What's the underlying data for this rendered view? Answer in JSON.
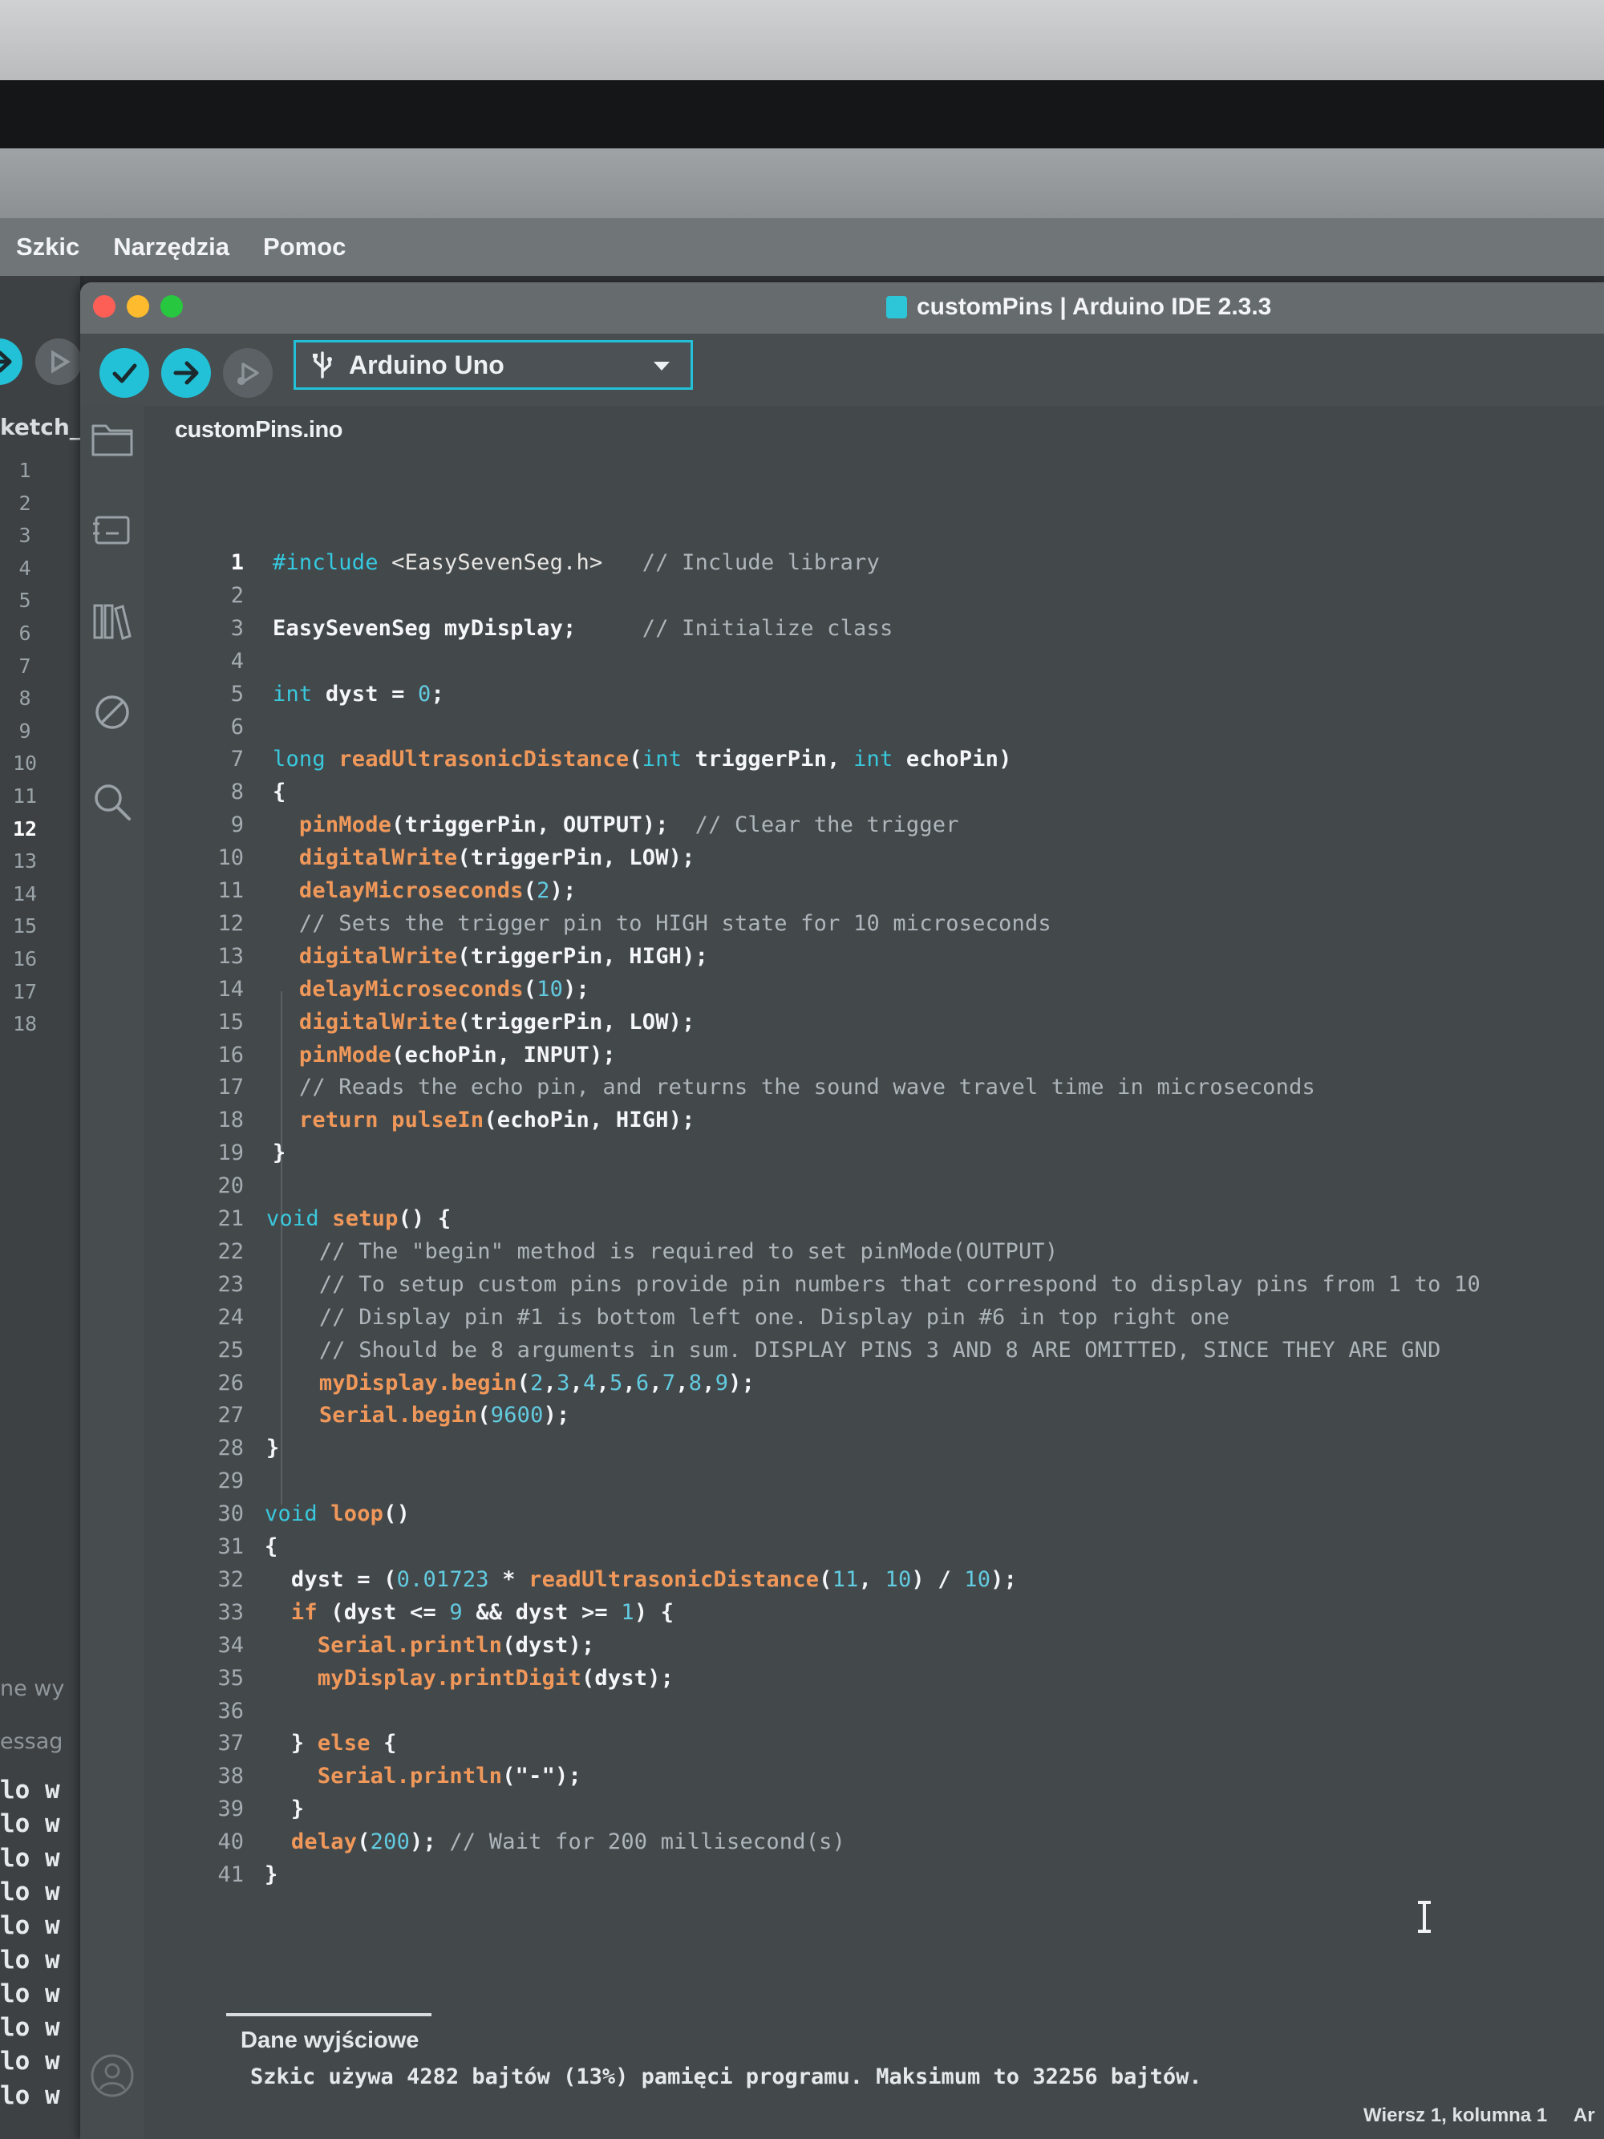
{
  "menubar": {
    "items": [
      "Szkic",
      "Narzędzia",
      "Pomoc"
    ]
  },
  "window": {
    "title": "customPins | Arduino IDE 2.3.3"
  },
  "toolbar": {
    "verify_icon": "check-icon",
    "upload_icon": "arrow-right-icon",
    "debug_icon": "debug-icon",
    "board_selector": {
      "label": "Arduino Uno",
      "icon": "usb-icon"
    }
  },
  "background_window": {
    "tab_label": "ketch_ju",
    "line_numbers": [
      "1",
      "2",
      "3",
      "4",
      "5",
      "6",
      "7",
      "8",
      "9",
      "10",
      "11",
      "12",
      "13",
      "14",
      "15",
      "16",
      "17",
      "18"
    ],
    "current_line": "12",
    "panel_fragments": [
      "ne wy",
      "essag"
    ],
    "output_lines": [
      "lo w",
      "lo w",
      "lo w",
      "lo w",
      "lo w",
      "lo w",
      "lo w",
      "lo w",
      "lo w",
      "lo w"
    ]
  },
  "sidebar": {
    "icons": [
      "folder-icon",
      "board-manager-icon",
      "library-icon",
      "debug-off-icon",
      "search-icon"
    ]
  },
  "editor": {
    "tab_label": "customPins.ino",
    "current_line": "1",
    "lines": [
      [
        [
          "p",
          "#include "
        ],
        [
          "s",
          "<EasySevenSeg.h>"
        ],
        [
          "c",
          "   // Include library"
        ]
      ],
      [],
      [
        [
          "t",
          "EasySevenSeg myDisplay;"
        ],
        [
          "c",
          "     // Initialize class"
        ]
      ],
      [],
      [
        [
          "k",
          "int"
        ],
        [
          "t",
          " dyst = "
        ],
        [
          "n",
          "0"
        ],
        [
          "t",
          ";"
        ]
      ],
      [],
      [
        [
          "k",
          "long "
        ],
        [
          "f",
          "readUltrasonicDistance"
        ],
        [
          "t",
          "("
        ],
        [
          "k",
          "int"
        ],
        [
          "t",
          " triggerPin, "
        ],
        [
          "k",
          "int"
        ],
        [
          "t",
          " echoPin)"
        ]
      ],
      [
        [
          "t",
          "{"
        ]
      ],
      [
        [
          "t",
          "  "
        ],
        [
          "o",
          "pinMode"
        ],
        [
          "t",
          "(triggerPin, OUTPUT);"
        ],
        [
          "c",
          "  // Clear the trigger"
        ]
      ],
      [
        [
          "t",
          "  "
        ],
        [
          "o",
          "digitalWrite"
        ],
        [
          "t",
          "(triggerPin, LOW);"
        ]
      ],
      [
        [
          "t",
          "  "
        ],
        [
          "o",
          "delayMicroseconds"
        ],
        [
          "t",
          "("
        ],
        [
          "n",
          "2"
        ],
        [
          "t",
          ");"
        ]
      ],
      [
        [
          "c",
          "  // Sets the trigger pin to HIGH state for 10 microseconds"
        ]
      ],
      [
        [
          "t",
          "  "
        ],
        [
          "o",
          "digitalWrite"
        ],
        [
          "t",
          "(triggerPin, HIGH);"
        ]
      ],
      [
        [
          "t",
          "  "
        ],
        [
          "o",
          "delayMicroseconds"
        ],
        [
          "t",
          "("
        ],
        [
          "n",
          "10"
        ],
        [
          "t",
          ");"
        ]
      ],
      [
        [
          "t",
          "  "
        ],
        [
          "o",
          "digitalWrite"
        ],
        [
          "t",
          "(triggerPin, LOW);"
        ]
      ],
      [
        [
          "t",
          "  "
        ],
        [
          "o",
          "pinMode"
        ],
        [
          "t",
          "(echoPin, INPUT);"
        ]
      ],
      [
        [
          "c",
          "  // Reads the echo pin, and returns the sound wave travel time in microseconds"
        ]
      ],
      [
        [
          "t",
          "  "
        ],
        [
          "o",
          "return "
        ],
        [
          "o",
          "pulseIn"
        ],
        [
          "t",
          "(echoPin, HIGH);"
        ]
      ],
      [
        [
          "t",
          "}"
        ]
      ],
      [],
      [
        [
          "k",
          "void "
        ],
        [
          "f",
          "setup"
        ],
        [
          "t",
          "() {"
        ]
      ],
      [
        [
          "c",
          "    // The \"begin\" method is required to set pinMode(OUTPUT)"
        ]
      ],
      [
        [
          "c",
          "    // To setup custom pins provide pin numbers that correspond to display pins from 1 to 10"
        ]
      ],
      [
        [
          "c",
          "    // Display pin #1 is bottom left one. Display pin #6 in top right one"
        ]
      ],
      [
        [
          "c",
          "    // Should be 8 arguments in sum. DISPLAY PINS 3 AND 8 ARE OMITTED, SINCE THEY ARE GND"
        ]
      ],
      [
        [
          "t",
          "    "
        ],
        [
          "o",
          "myDisplay.begin"
        ],
        [
          "t",
          "("
        ],
        [
          "n",
          "2"
        ],
        [
          "t",
          ","
        ],
        [
          "n",
          "3"
        ],
        [
          "t",
          ","
        ],
        [
          "n",
          "4"
        ],
        [
          "t",
          ","
        ],
        [
          "n",
          "5"
        ],
        [
          "t",
          ","
        ],
        [
          "n",
          "6"
        ],
        [
          "t",
          ","
        ],
        [
          "n",
          "7"
        ],
        [
          "t",
          ","
        ],
        [
          "n",
          "8"
        ],
        [
          "t",
          ","
        ],
        [
          "n",
          "9"
        ],
        [
          "t",
          ");"
        ]
      ],
      [
        [
          "t",
          "    "
        ],
        [
          "o",
          "Serial.begin"
        ],
        [
          "t",
          "("
        ],
        [
          "n",
          "9600"
        ],
        [
          "t",
          ");"
        ]
      ],
      [
        [
          "t",
          "}"
        ]
      ],
      [],
      [
        [
          "k",
          "void "
        ],
        [
          "f",
          "loop"
        ],
        [
          "t",
          "()"
        ]
      ],
      [
        [
          "t",
          "{"
        ]
      ],
      [
        [
          "t",
          "  dyst = ("
        ],
        [
          "n",
          "0.01723"
        ],
        [
          "t",
          " * "
        ],
        [
          "f",
          "readUltrasonicDistance"
        ],
        [
          "t",
          "("
        ],
        [
          "n",
          "11"
        ],
        [
          "t",
          ", "
        ],
        [
          "n",
          "10"
        ],
        [
          "t",
          ") / "
        ],
        [
          "n",
          "10"
        ],
        [
          "t",
          ");"
        ]
      ],
      [
        [
          "t",
          "  "
        ],
        [
          "o",
          "if"
        ],
        [
          "t",
          " (dyst <= "
        ],
        [
          "n",
          "9"
        ],
        [
          "t",
          " && dyst >= "
        ],
        [
          "n",
          "1"
        ],
        [
          "t",
          ") {"
        ]
      ],
      [
        [
          "t",
          "    "
        ],
        [
          "o",
          "Serial.println"
        ],
        [
          "t",
          "(dyst);"
        ]
      ],
      [
        [
          "t",
          "    "
        ],
        [
          "o",
          "myDisplay.printDigit"
        ],
        [
          "t",
          "(dyst);"
        ]
      ],
      [],
      [
        [
          "t",
          "  } "
        ],
        [
          "o",
          "else"
        ],
        [
          "t",
          " {"
        ]
      ],
      [
        [
          "t",
          "    "
        ],
        [
          "o",
          "Serial.println"
        ],
        [
          "t",
          "(\"-\");"
        ]
      ],
      [
        [
          "t",
          "  }"
        ]
      ],
      [
        [
          "t",
          "  "
        ],
        [
          "o",
          "delay"
        ],
        [
          "t",
          "("
        ],
        [
          "n",
          "200"
        ],
        [
          "t",
          ");"
        ],
        [
          "c",
          " // Wait for 200 millisecond(s)"
        ]
      ],
      [
        [
          "t",
          "}"
        ]
      ]
    ]
  },
  "output": {
    "tab_label": "Dane wyjściowe",
    "message": "Szkic używa 4282 bajtów (13%) pamięci programu. Maksimum to 32256 bajtów."
  },
  "statusbar": {
    "position": "Wiersz 1, kolumna 1",
    "trailing": "Ar"
  },
  "colors": {
    "accent": "#23c1d7",
    "keyword": "#3ac8dc",
    "function": "#f0985a",
    "comment": "#aeb6bb",
    "background": "#43484b"
  }
}
